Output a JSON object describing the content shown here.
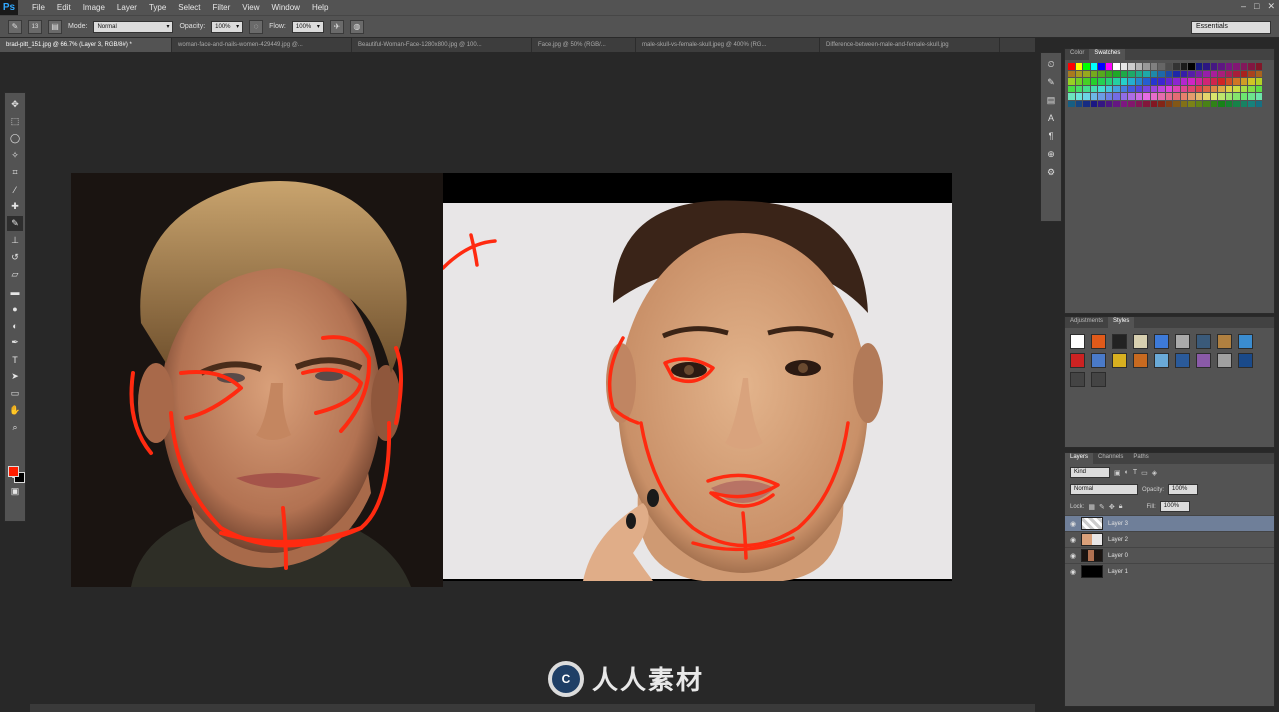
{
  "app": {
    "logo": "Ps"
  },
  "menu": [
    "File",
    "Edit",
    "Image",
    "Layer",
    "Type",
    "Select",
    "Filter",
    "View",
    "Window",
    "Help"
  ],
  "window_controls": [
    "–",
    "□",
    "✕"
  ],
  "options": {
    "brush_size": "13",
    "mode_label": "Mode:",
    "mode_value": "Normal",
    "opacity_label": "Opacity:",
    "opacity_value": "100%",
    "flow_label": "Flow:",
    "flow_value": "100%",
    "workspace": "Essentials"
  },
  "tabs": [
    "brad-pitt_151.jpg @ 66.7% (Layer 3, RGB/8#) *",
    "woman-face-and-nails-women-429449.jpg @...",
    "Beautiful-Woman-Face-1280x800.jpg @ 100...",
    "Face.jpg @ 50% (RGB/...",
    "male-skull-vs-female-skull.jpeg @ 400% (RG...",
    "Difference-between-male-and-female-skull.jpg"
  ],
  "tools_icons": [
    "move-icon",
    "marquee-icon",
    "lasso-icon",
    "quick-select-icon",
    "crop-icon",
    "eyedropper-icon",
    "healing-icon",
    "brush-icon",
    "stamp-icon",
    "history-brush-icon",
    "eraser-icon",
    "gradient-icon",
    "blur-icon",
    "dodge-icon",
    "pen-icon",
    "type-icon",
    "path-select-icon",
    "shape-icon",
    "hand-icon",
    "zoom-icon"
  ],
  "colors": {
    "foreground": "#ff1d00",
    "background": "#000000",
    "accent": "#6f7f99"
  },
  "color_panel": {
    "tabs": [
      "Color",
      "Swatches"
    ]
  },
  "adjustments_panel": {
    "tabs": [
      "Adjustments",
      "Styles"
    ]
  },
  "layers_panel": {
    "tabs": [
      "Layers",
      "Channels",
      "Paths"
    ],
    "kind": "Kind",
    "blend": "Normal",
    "opacity_label": "Opacity:",
    "opacity": "100%",
    "lock_label": "Lock:",
    "fill_label": "Fill:",
    "fill": "100%",
    "layers": [
      {
        "name": "Layer 3",
        "selected": true
      },
      {
        "name": "Layer 2",
        "selected": false
      },
      {
        "name": "Layer 0",
        "selected": false
      },
      {
        "name": "Layer 1",
        "selected": false
      }
    ]
  },
  "watermark": {
    "logo": "C",
    "text": "人人素材"
  }
}
